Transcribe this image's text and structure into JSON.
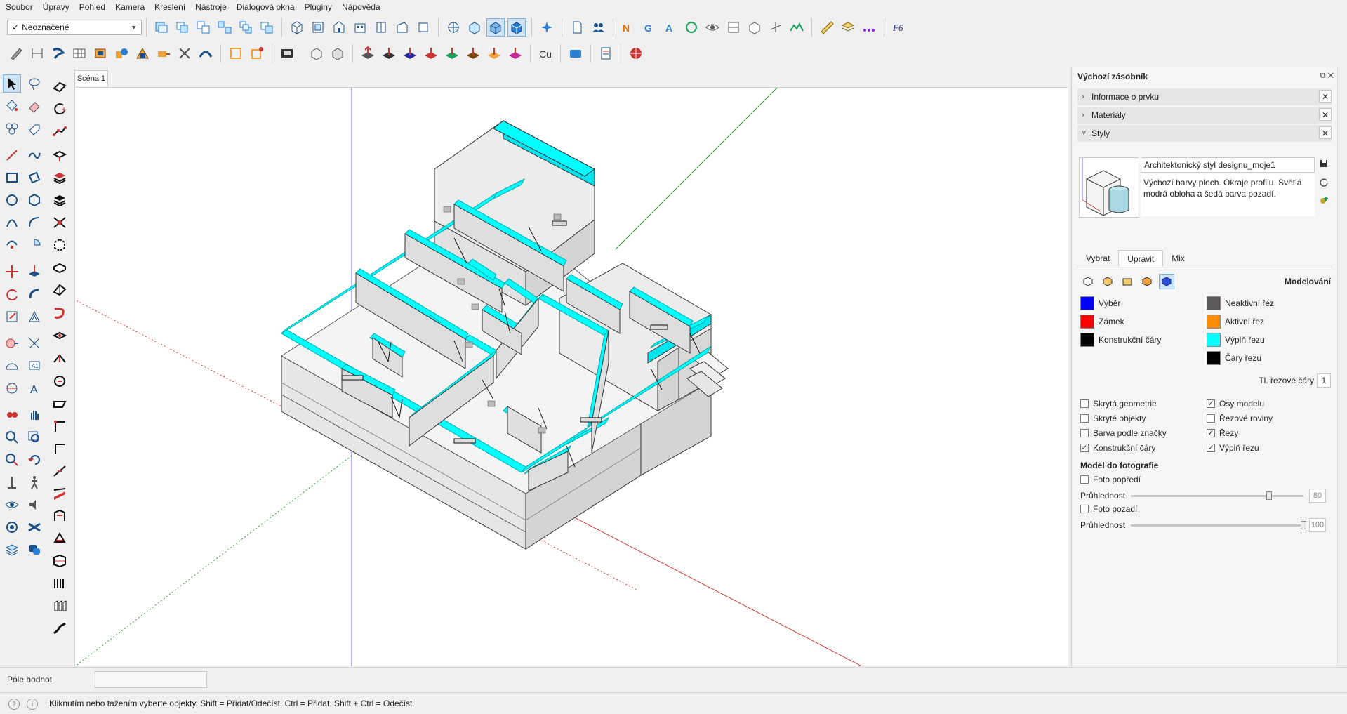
{
  "menu": [
    "Soubor",
    "Úpravy",
    "Pohled",
    "Kamera",
    "Kreslení",
    "Nástroje",
    "Dialogová okna",
    "Pluginy",
    "Nápověda"
  ],
  "tag_select": {
    "check": "✓",
    "value": "Neoznačené"
  },
  "scene_tab": "Scéna 1",
  "tray": {
    "title": "Výchozí zásobník",
    "pins": "⧉ ✕",
    "panels": [
      {
        "label": "Informace o prvku",
        "caret": "›"
      },
      {
        "label": "Materiály",
        "caret": "›"
      },
      {
        "label": "Styly",
        "caret": "˅"
      }
    ],
    "close": "✕",
    "style": {
      "name": "Architektonický styl designu_moje1",
      "description": "Výchozí barvy ploch. Okraje profilu. Světlá modrá obloha a šedá barva pozadí."
    },
    "tabs": [
      "Vybrat",
      "Upravit",
      "Mix"
    ],
    "mode_label": "Modelování",
    "colors_left": [
      {
        "label": "Výběr",
        "color": "#0000ff"
      },
      {
        "label": "Zámek",
        "color": "#ff0000"
      },
      {
        "label": "Konstrukční čáry",
        "color": "#000000"
      }
    ],
    "colors_right": [
      {
        "label": "Neaktivní řez",
        "color": "#5e5a5a"
      },
      {
        "label": "Aktivní řez",
        "color": "#ff8c00"
      },
      {
        "label": "Výplň řezu",
        "color": "#00ffff"
      },
      {
        "label": "Čáry řezu",
        "color": "#000000"
      }
    ],
    "thickness": {
      "label": "Tl. řezové čáry",
      "value": "1"
    },
    "checks_left": [
      {
        "label": "Skrytá geometrie",
        "checked": ""
      },
      {
        "label": "Skryté objekty",
        "checked": ""
      },
      {
        "label": "Barva podle značky",
        "checked": ""
      },
      {
        "label": "Konstrukční čáry",
        "checked": "✓"
      }
    ],
    "checks_right": [
      {
        "label": "Osy modelu",
        "checked": "✓"
      },
      {
        "label": "Řezové roviny",
        "checked": ""
      },
      {
        "label": "Řezy",
        "checked": "✓"
      },
      {
        "label": "Výplň řezu",
        "checked": "✓"
      }
    ],
    "photo": {
      "title": "Model do fotografie",
      "front": {
        "label": "Foto popředí",
        "checked": ""
      },
      "front_opacity": {
        "label": "Průhlednost",
        "value": "80",
        "fraction": 0.8
      },
      "back": {
        "label": "Foto pozadí",
        "checked": ""
      },
      "back_opacity": {
        "label": "Průhlednost",
        "value": "100",
        "fraction": 1.0
      }
    }
  },
  "vcb": {
    "label": "Pole hodnot",
    "value": ""
  },
  "status": {
    "icon1": "?",
    "icon2": "i",
    "text": "Kliknutím nebo tažením vyberte objekty. Shift = Přidat/Odečíst. Ctrl = Přidat. Shift + Ctrl = Odečíst."
  },
  "colors": {
    "section_fill": "#00ffff",
    "wall": "#e6e6e6",
    "accent": "#0b74d6"
  }
}
